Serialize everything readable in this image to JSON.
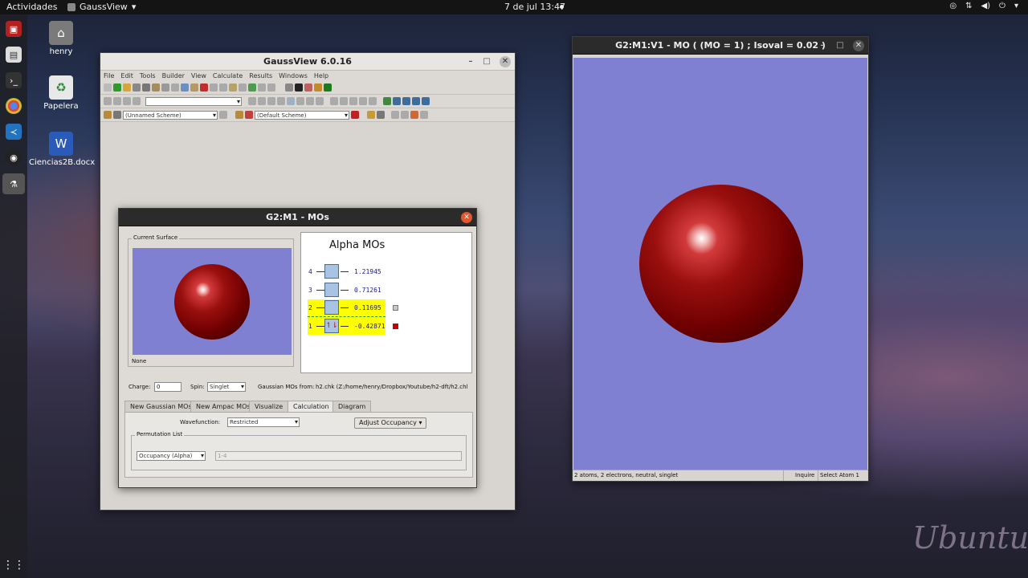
{
  "topbar": {
    "activities": "Actividades",
    "app_name": "GaussView",
    "clock": "7 de jul  13:47"
  },
  "desktop": {
    "icons": [
      {
        "label": "henry",
        "icon": "home-folder-icon"
      },
      {
        "label": "Papelera",
        "icon": "trash-icon"
      },
      {
        "label": "Ciencias2B.docx",
        "icon": "word-document-icon"
      }
    ],
    "watermark": "Ubuntu"
  },
  "main_window": {
    "title": "GaussView 6.0.16",
    "menu": [
      "File",
      "Edit",
      "Tools",
      "Builder",
      "View",
      "Calculate",
      "Results",
      "Windows",
      "Help"
    ],
    "scheme_left": "(Unnamed Scheme)",
    "scheme_right": "(Default Scheme)"
  },
  "mo_dialog": {
    "title": "G2:M1 - MOs",
    "current_surface_label": "Current Surface",
    "surface_name": "None",
    "diagram_title": "Alpha MOs",
    "orbitals": [
      {
        "index": "4",
        "energy": "1.21945",
        "occupied": false
      },
      {
        "index": "3",
        "energy": "0.71261",
        "occupied": false
      },
      {
        "index": "2",
        "energy": "0.11695",
        "occupied": false
      },
      {
        "index": "1",
        "energy": "-0.42871",
        "occupied": true
      }
    ],
    "charge_label": "Charge:",
    "charge_value": "0",
    "spin_label": "Spin:",
    "spin_value": "Singlet",
    "source_label": "Gaussian MOs from:",
    "source_value": "h2.chk (Z:/home/henry/Dropbox/Youtube/h2-dft/h2.chl",
    "tabs": [
      "New Gaussian MOs",
      "New Ampac MOs",
      "Visualize",
      "Calculation",
      "Diagram"
    ],
    "active_tab": "Calculation",
    "wavefunction_label": "Wavefunction:",
    "wavefunction_value": "Restricted",
    "adjust_occupancy": "Adjust Occupancy",
    "permutation_label": "Permutation List",
    "permutation_combo": "Occupancy (Alpha)",
    "permutation_value": "1-4"
  },
  "mo_view": {
    "title": "G2:M1:V1 - MO ( (MO = 1) ; Isoval = 0.02 )",
    "status_text": "2 atoms, 2 electrons, neutral, singlet",
    "status_mode": "Inquire",
    "status_select": "Select Atom 1"
  },
  "colors": {
    "viewport_bg": "#8080d2",
    "sphere": "#8b0000",
    "highlight": "#ffff00",
    "unoccupied_box": "#a9c3e3"
  }
}
